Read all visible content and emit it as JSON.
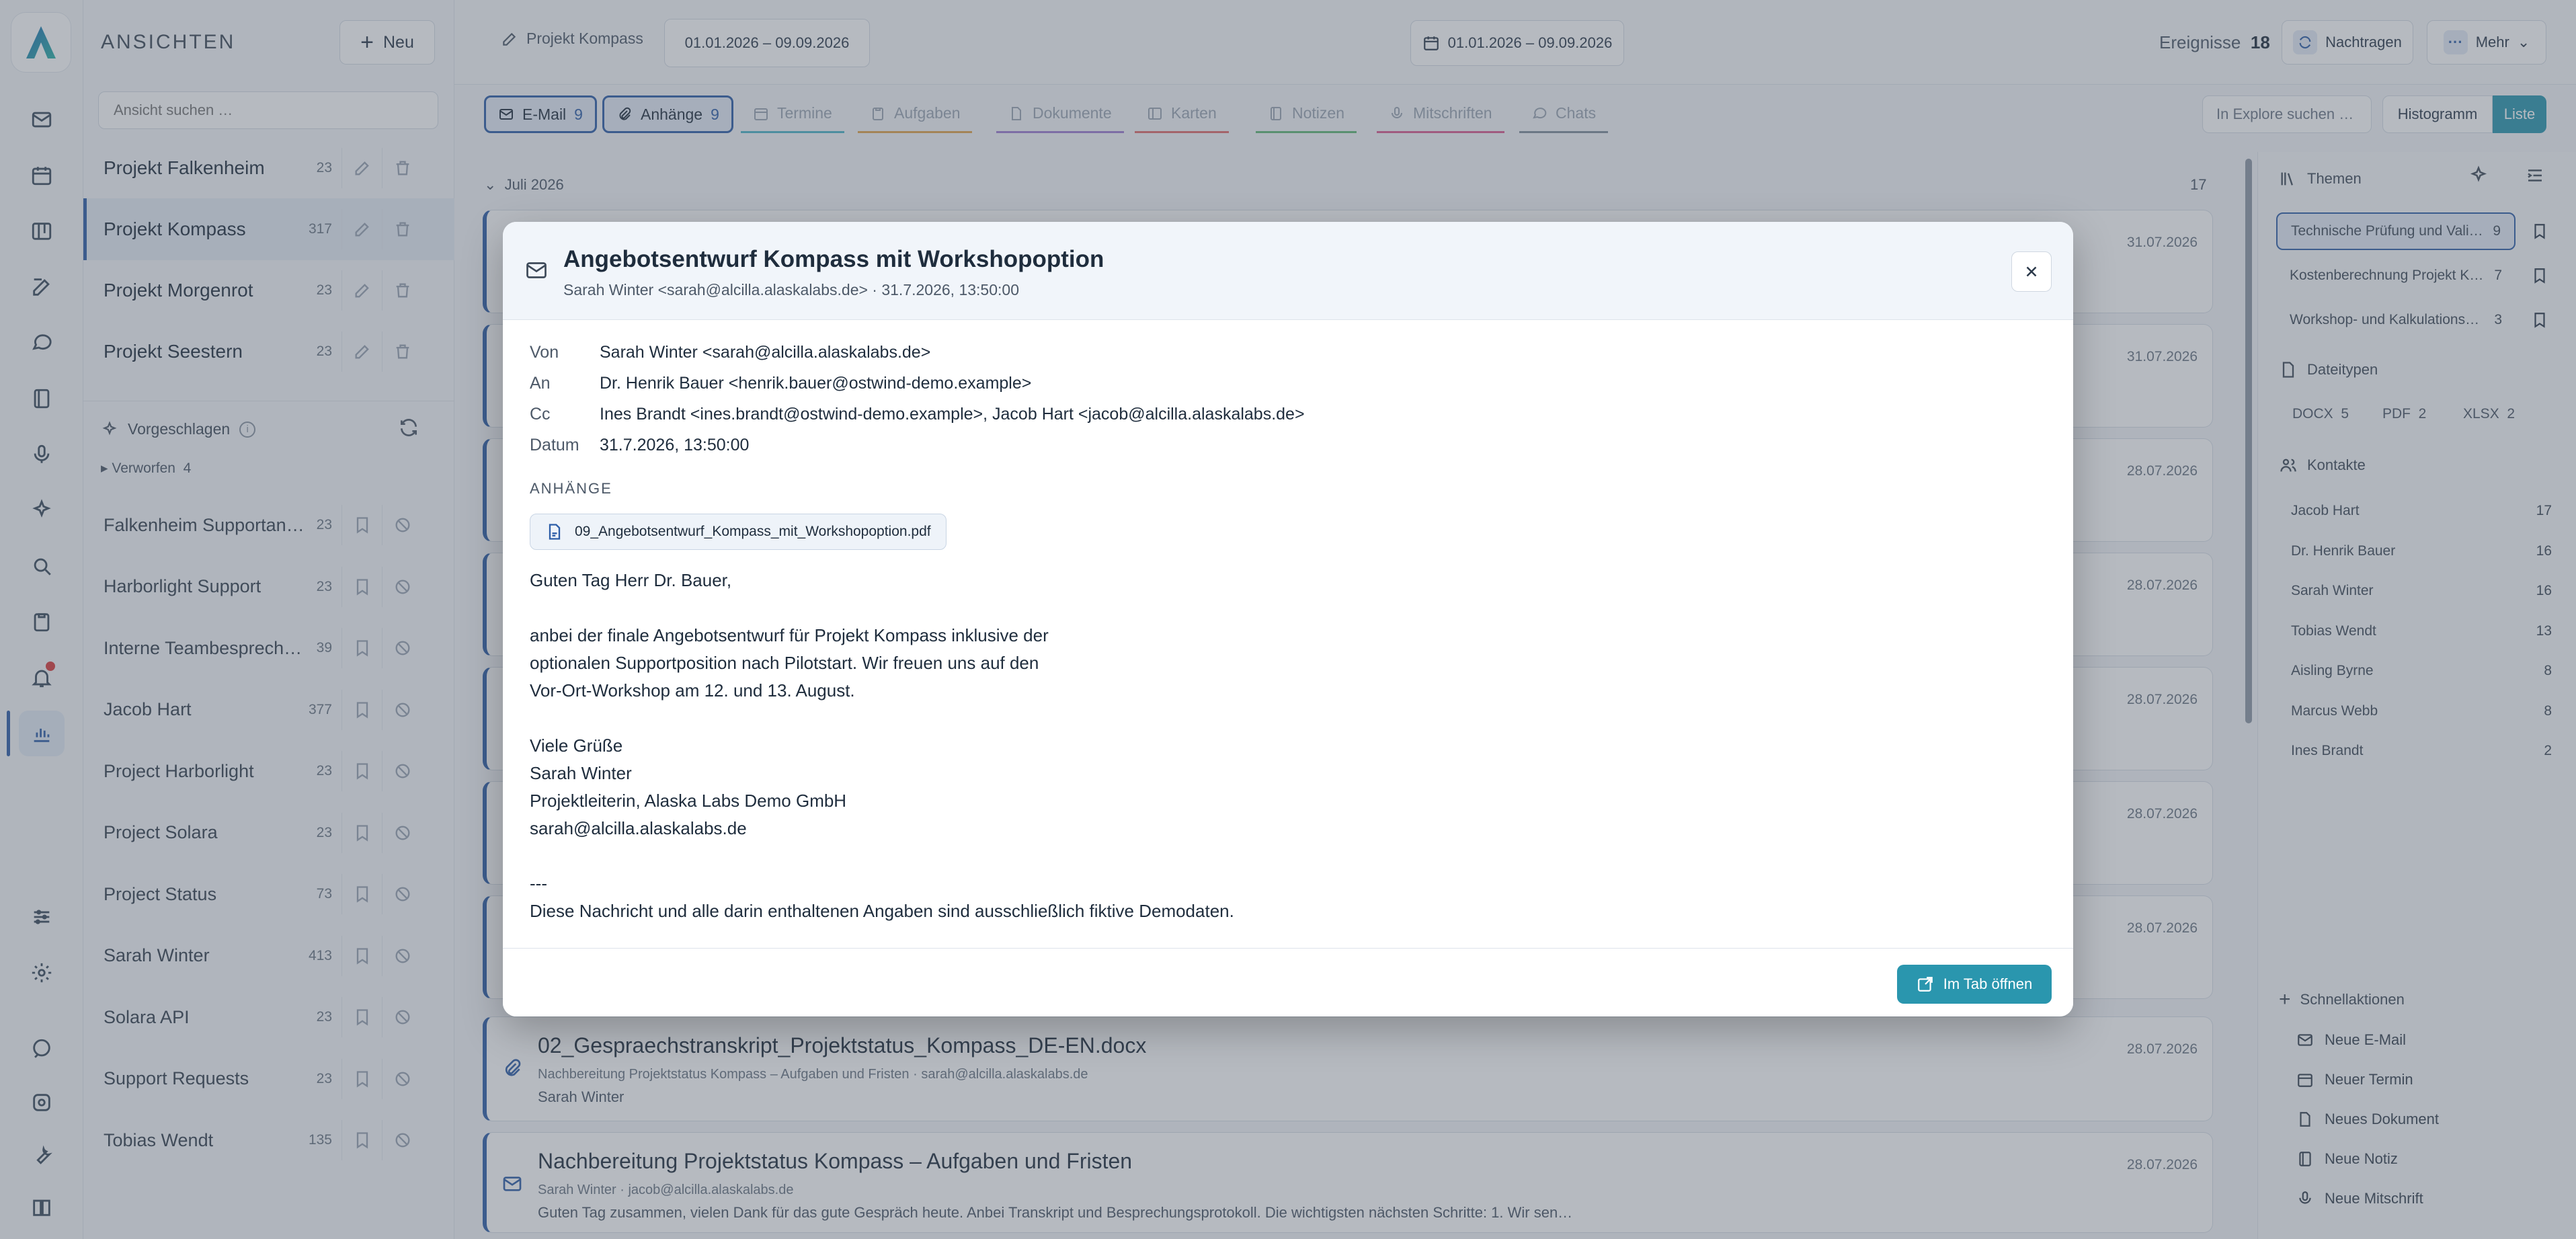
{
  "sidebar": {
    "title": "ANSICHTEN",
    "new_label": "Neu",
    "search_placeholder": "Ansicht suchen …",
    "views": [
      {
        "name": "Projekt Falkenheim",
        "count": "23"
      },
      {
        "name": "Projekt Kompass",
        "count": "317"
      },
      {
        "name": "Projekt Morgenrot",
        "count": "23"
      },
      {
        "name": "Projekt Seestern",
        "count": "23"
      }
    ],
    "suggested_label": "Vorgeschlagen",
    "discarded_label": "Verworfen",
    "discarded_count": "4",
    "suggestions": [
      {
        "name": "Falkenheim Supportanf…",
        "count": "23"
      },
      {
        "name": "Harborlight Support",
        "count": "23"
      },
      {
        "name": "Interne Teambesprechu…",
        "count": "39"
      },
      {
        "name": "Jacob Hart",
        "count": "377"
      },
      {
        "name": "Project Harborlight",
        "count": "23"
      },
      {
        "name": "Project Solara",
        "count": "23"
      },
      {
        "name": "Project Status",
        "count": "73"
      },
      {
        "name": "Sarah Winter",
        "count": "413"
      },
      {
        "name": "Solara API",
        "count": "23"
      },
      {
        "name": "Support Requests",
        "count": "23"
      },
      {
        "name": "Tobias Wendt",
        "count": "135"
      }
    ]
  },
  "topbar": {
    "crumb": "Projekt Kompass",
    "range_pill": "01.01.2026 – 09.09.2026",
    "range_center": "01.01.2026 – 09.09.2026",
    "events_label": "Ereignisse",
    "events_count": "18",
    "reload_label": "Nachtragen",
    "more_label": "Mehr"
  },
  "filters": {
    "tabs": [
      {
        "label": "E-Mail",
        "count": "9",
        "on": true,
        "color": "#2d5ea8"
      },
      {
        "label": "Anhänge",
        "count": "9",
        "on": true,
        "color": "#2d5ea8"
      },
      {
        "label": "Termine",
        "count": "",
        "on": false,
        "color": "#4bb3c6"
      },
      {
        "label": "Aufgaben",
        "count": "",
        "on": false,
        "color": "#e0a24a"
      },
      {
        "label": "Dokumente",
        "count": "",
        "on": false,
        "color": "#9d7ad1"
      },
      {
        "label": "Karten",
        "count": "",
        "on": false,
        "color": "#e06b6b"
      },
      {
        "label": "Notizen",
        "count": "",
        "on": false,
        "color": "#5fb776"
      },
      {
        "label": "Mitschriften",
        "count": "",
        "on": false,
        "color": "#d95a8f"
      },
      {
        "label": "Chats",
        "count": "",
        "on": false,
        "color": "#7f8c99"
      }
    ],
    "explore_placeholder": "In Explore suchen …",
    "histogram_label": "Histogramm",
    "list_label": "Liste"
  },
  "timeline": {
    "group_label": "Juli 2026",
    "group_count": "17",
    "dates": [
      "31.07.2026",
      "31.07.2026",
      "28.07.2026",
      "28.07.2026",
      "28.07.2026",
      "28.07.2026",
      "28.07.2026"
    ],
    "cards": [
      {
        "title": "02_Gespraechstranskript_Projektstatus_Kompass_DE-EN.docx",
        "sub": "Nachbereitung Projektstatus Kompass – Aufgaben und Fristen · sarah@alcilla.alaskalabs.de",
        "sub2": "Sarah Winter",
        "date": "28.07.2026"
      },
      {
        "title": "Nachbereitung Projektstatus Kompass – Aufgaben und Fristen",
        "sub": "Sarah Winter · jacob@alcilla.alaskalabs.de",
        "sub2": "Guten Tag zusammen, vielen Dank für das gute Gespräch heute. Anbei Transkript und Besprechungsprotokoll. Die wichtigsten nächsten Schritte: 1. Wir sen…",
        "date": "28.07.2026"
      }
    ]
  },
  "right": {
    "themes_label": "Themen",
    "themes": [
      {
        "name": "Technische Prüfung und Vali…",
        "count": "9"
      },
      {
        "name": "Kostenberechnung Projekt K…",
        "count": "7"
      },
      {
        "name": "Workshop- und Kalkulations…",
        "count": "3"
      }
    ],
    "filetypes_label": "Dateitypen",
    "filetypes": [
      {
        "name": "DOCX",
        "count": "5"
      },
      {
        "name": "PDF",
        "count": "2"
      },
      {
        "name": "XLSX",
        "count": "2"
      }
    ],
    "contacts_label": "Kontakte",
    "contacts": [
      {
        "name": "Jacob Hart",
        "count": "17"
      },
      {
        "name": "Dr. Henrik Bauer",
        "count": "16"
      },
      {
        "name": "Sarah Winter",
        "count": "16"
      },
      {
        "name": "Tobias Wendt",
        "count": "13"
      },
      {
        "name": "Aisling Byrne",
        "count": "8"
      },
      {
        "name": "Marcus Webb",
        "count": "8"
      },
      {
        "name": "Ines Brandt",
        "count": "2"
      }
    ],
    "quick_label": "Schnellaktionen",
    "quick": [
      "Neue E-Mail",
      "Neuer Termin",
      "Neues Dokument",
      "Neue Notiz",
      "Neue Mitschrift"
    ]
  },
  "modal": {
    "title": "Angebotsentwurf Kompass mit Workshopoption",
    "subtitle": "Sarah Winter <sarah@alcilla.alaskalabs.de> · 31.7.2026, 13:50:00",
    "headers": [
      {
        "k": "Von",
        "v": "Sarah Winter <sarah@alcilla.alaskalabs.de>"
      },
      {
        "k": "An",
        "v": "Dr. Henrik Bauer <henrik.bauer@ostwind-demo.example>"
      },
      {
        "k": "Cc",
        "v": "Ines Brandt <ines.brandt@ostwind-demo.example>, Jacob Hart <jacob@alcilla.alaskalabs.de>"
      },
      {
        "k": "Datum",
        "v": "31.7.2026, 13:50:00"
      }
    ],
    "attachments_label": "ANHÄNGE",
    "attachment": "09_Angebotsentwurf_Kompass_mit_Workshopoption.pdf",
    "body": [
      "Guten Tag Herr Dr. Bauer,",
      "",
      "anbei der finale Angebotsentwurf für Projekt Kompass inklusive der",
      "optionalen Supportposition nach Pilotstart. Wir freuen uns auf den",
      "Vor-Ort-Workshop am 12. und 13. August.",
      "",
      "Viele Grüße",
      "Sarah Winter",
      "Projektleiterin, Alaska Labs Demo GmbH",
      "sarah@alcilla.alaskalabs.de",
      "",
      "---",
      "Diese Nachricht und alle darin enthaltenen Angaben sind ausschließlich fiktive Demodaten."
    ],
    "open_label": "Im Tab öffnen"
  }
}
